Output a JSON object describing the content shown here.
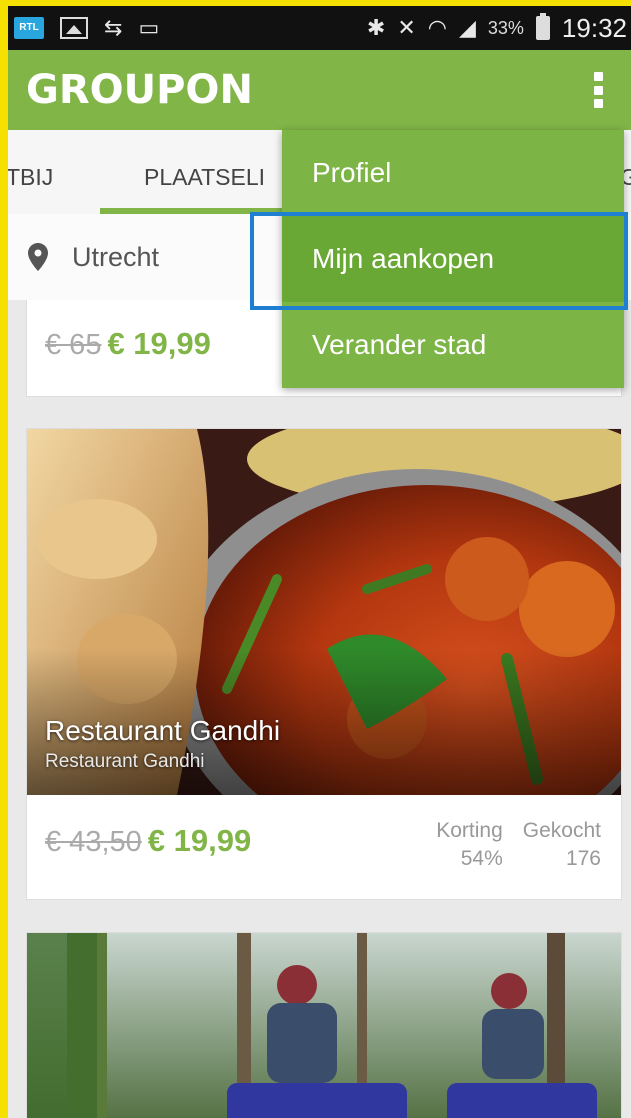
{
  "status_bar": {
    "battery": "33%",
    "time": "19:32",
    "icons": [
      "rtl-icon",
      "image-icon",
      "sync-icon",
      "pill-icon",
      "bluetooth-icon",
      "mute-icon",
      "wifi-icon",
      "signal-icon",
      "battery-icon"
    ]
  },
  "app_bar": {
    "logo": "GROUPON",
    "overflow_icon": "more-vert-icon"
  },
  "tabs": {
    "items": [
      {
        "label": "TBIJ"
      },
      {
        "label": "PLAATSELI"
      },
      {
        "label": "G"
      }
    ],
    "active_index": 1
  },
  "location": {
    "icon": "location-pin-icon",
    "city": "Utrecht"
  },
  "menu": {
    "items": [
      {
        "label": "Profiel"
      },
      {
        "label": "Mijn aankopen"
      },
      {
        "label": "Verander stad"
      }
    ],
    "highlighted_index": 1
  },
  "deals": [
    {
      "old_price": "€ 65",
      "new_price": "€ 19,99"
    },
    {
      "title": "Restaurant Gandhi",
      "subtitle": "Restaurant Gandhi",
      "old_price": "€ 43,50",
      "new_price": "€ 19,99",
      "discount_label": "Korting",
      "discount_value": "54%",
      "bought_label": "Gekocht",
      "bought_value": "176"
    },
    {
      "image": "quad-bike-forest-photo"
    }
  ],
  "colors": {
    "brand_green": "#82b548",
    "menu_green": "#7db446",
    "highlight_blue": "#1f7fd0"
  }
}
